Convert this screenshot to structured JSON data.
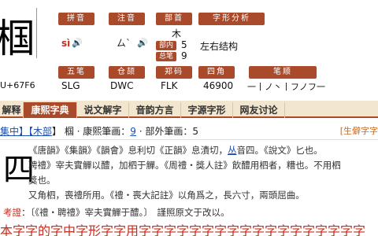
{
  "big_char": "椢",
  "unicode": "U+67F6",
  "labels": {
    "pinyin": "拼音",
    "zhuyin": "注音",
    "bushou": "部首",
    "analysis": "字形分析",
    "bunei": "部内",
    "bihua": "总笔画",
    "wubi": "五笔",
    "cangjie": "仓颉",
    "zhengma": "郑码",
    "sijiao": "四角",
    "bishun": "笔顺"
  },
  "values": {
    "pinyin": "sì",
    "zhuyin": "ㄙˋ",
    "bushou": "木",
    "bunei": "5",
    "bihua": "9",
    "analysis": "左右结构",
    "wubi": "SLG",
    "cangjie": "DWC",
    "zhengma": "FLK",
    "sijiao": "46900",
    "bishun": "一丨ノ丶丨フノフ一"
  },
  "icons": {
    "speaker": "speaker-icon"
  },
  "tabs": [
    {
      "label": "解释"
    },
    {
      "label": "康熙字典"
    },
    {
      "label": "说文解字"
    },
    {
      "label": "音韵方言"
    },
    {
      "label": "字源字形"
    },
    {
      "label": "网友讨论"
    }
  ],
  "entry": {
    "part1": "集中】【",
    "bu_link": "木部",
    "part2": "】 椢 · 康熙筆画：",
    "kx_strokes": "9",
    "part3": " · 部外筆画：5",
    "right_text": "[生僻字字",
    "kx_char": "四"
  },
  "kangxi_lines": [
    {
      "text": "《唐韻》《集韻》《韻會》息利切《正韻》息漬切，"
    },
    {
      "u": "丛",
      "text": "音四。《說文》匕也。"
    },
    {
      "text": "聘禮》宰夫實觶以醴，加柶于觶。《周禮・獎人註》飲醴用柶者，糟也。不用柶"
    },
    {
      "text": "獎也。"
    },
    {
      "text": "又角柶，喪禮所用。《禮・喪大記註》以角爲之，長六寸，兩頭屈曲。"
    }
  ],
  "note": {
    "title": "考證",
    "text": "：〔《禮・聘禮》宰夫實觶于醴。〕　謹照原文于改以。"
  },
  "bottom_text": "本字字的字中字形字字用字字字字字字字字字字字字字字字字字字"
}
